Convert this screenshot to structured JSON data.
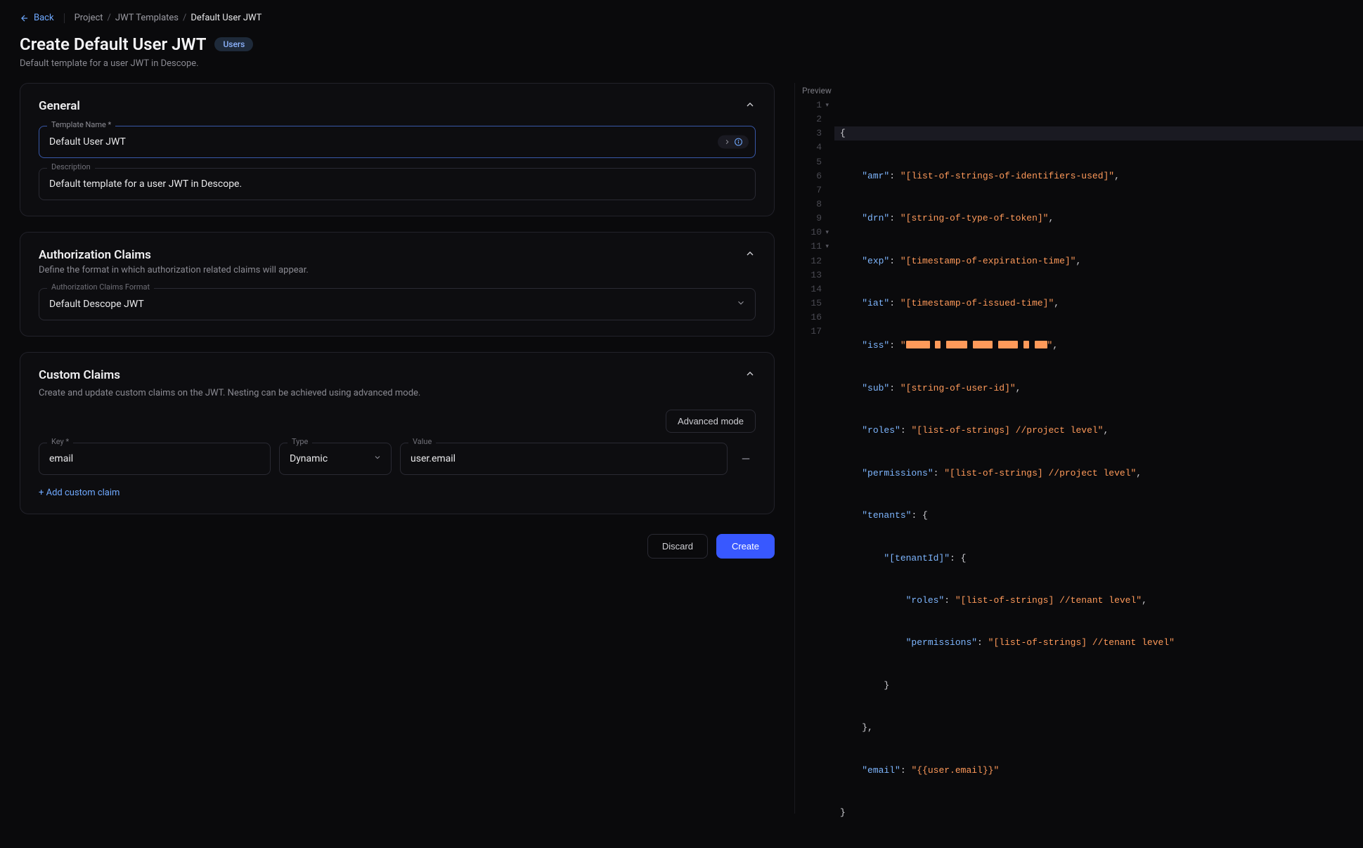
{
  "topbar": {
    "back_label": "Back",
    "breadcrumb": {
      "segment1": "Project",
      "segment2": "JWT Templates",
      "current": "Default User JWT"
    }
  },
  "header": {
    "title": "Create Default User JWT",
    "badge": "Users",
    "subtitle": "Default template for a user JWT in Descope."
  },
  "general": {
    "title": "General",
    "name_label": "Template Name *",
    "name_value": "Default User JWT",
    "desc_label": "Description",
    "desc_value": "Default template for a user JWT in Descope."
  },
  "authz": {
    "title": "Authorization Claims",
    "subtitle": "Define the format in which authorization related claims will appear.",
    "format_label": "Authorization Claims Format",
    "format_value": "Default Descope JWT"
  },
  "custom": {
    "title": "Custom Claims",
    "subtitle": "Create and update custom claims on the JWT. Nesting can be achieved using advanced mode.",
    "advanced_label": "Advanced mode",
    "key_label": "Key *",
    "type_label": "Type",
    "value_label": "Value",
    "row": {
      "key": "email",
      "type": "Dynamic",
      "value": "user.email"
    },
    "add_label": "+ Add custom claim"
  },
  "actions": {
    "discard": "Discard",
    "create": "Create"
  },
  "preview": {
    "label": "Preview",
    "line_numbers": [
      "1",
      "2",
      "3",
      "4",
      "5",
      "6",
      "7",
      "8",
      "9",
      "10",
      "11",
      "12",
      "13",
      "14",
      "15",
      "16",
      "17"
    ],
    "lines": {
      "l1": "{",
      "l2_key": "\"amr\"",
      "l2_val": "\"[list-of-strings-of-identifiers-used]\"",
      "l3_key": "\"drn\"",
      "l3_val": "\"[string-of-type-of-token]\"",
      "l4_key": "\"exp\"",
      "l4_val": "\"[timestamp-of-expiration-time]\"",
      "l5_key": "\"iat\"",
      "l5_val": "\"[timestamp-of-issued-time]\"",
      "l6_key": "\"iss\"",
      "l7_key": "\"sub\"",
      "l7_val": "\"[string-of-user-id]\"",
      "l8_key": "\"roles\"",
      "l8_val": "\"[list-of-strings] //project level\"",
      "l9_key": "\"permissions\"",
      "l9_val": "\"[list-of-strings] //project level\"",
      "l10_key": "\"tenants\"",
      "l11_key": "\"[tenantId]\"",
      "l12_key": "\"roles\"",
      "l12_val": "\"[list-of-strings] //tenant level\"",
      "l13_key": "\"permissions\"",
      "l13_val": "\"[list-of-strings] //tenant level\"",
      "l14": "}",
      "l15": "},",
      "l16_key": "\"email\"",
      "l16_val": "\"{{user.email}}\"",
      "l17": "}"
    }
  }
}
